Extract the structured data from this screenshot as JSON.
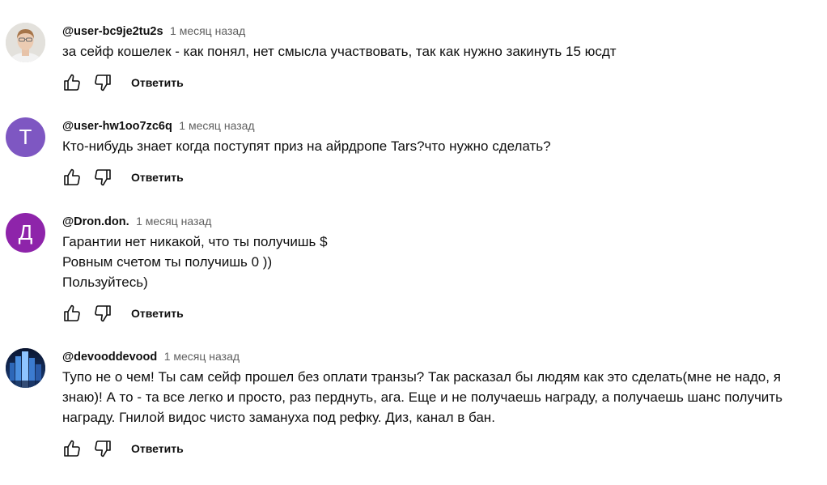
{
  "comments": [
    {
      "author": "@user-bc9je2tu2s",
      "time": "1 месяц назад",
      "text": "за сейф кошелек - как понял, нет смысла участвовать, так как нужно закинуть 15 юсдт",
      "avatar_letter": "",
      "avatar_color": "#d9d6d0",
      "avatar_kind": "photo-person",
      "reply_label": "Ответить"
    },
    {
      "author": "@user-hw1oo7zc6q",
      "time": "1 месяц назад",
      "text": "Кто-нибудь знает когда поступят приз на айрдропе Tars?что нужно сделать?",
      "avatar_letter": "T",
      "avatar_color": "#7e57c2",
      "avatar_kind": "letter",
      "reply_label": "Ответить"
    },
    {
      "author": "@Dron.don.",
      "time": "1 месяц назад",
      "text": "Гарантии нет никакой, что ты получишь $\nРовным счетом ты получишь 0 ))\nПользуйтесь)",
      "avatar_letter": "Д",
      "avatar_color": "#8e24aa",
      "avatar_kind": "letter",
      "reply_label": "Ответить"
    },
    {
      "author": "@devooddevood",
      "time": "1 месяц назад",
      "text": "Тупо не о чем! Ты сам сейф прошел без оплати транзы? Так расказал бы людям как это сделать(мне не надо, я знаю)! А то - та все легко и просто, раз перднуть, ага. Еще и не получаешь награду, а получаешь шанс получить награду.  Гнилой видос чисто замануха под рефку. Диз, канал в бан.",
      "avatar_letter": "",
      "avatar_color": "#0b1a3a",
      "avatar_kind": "photo-city",
      "reply_label": "Ответить"
    }
  ],
  "icons": {
    "like": "thumb-up-icon",
    "dislike": "thumb-down-icon"
  }
}
